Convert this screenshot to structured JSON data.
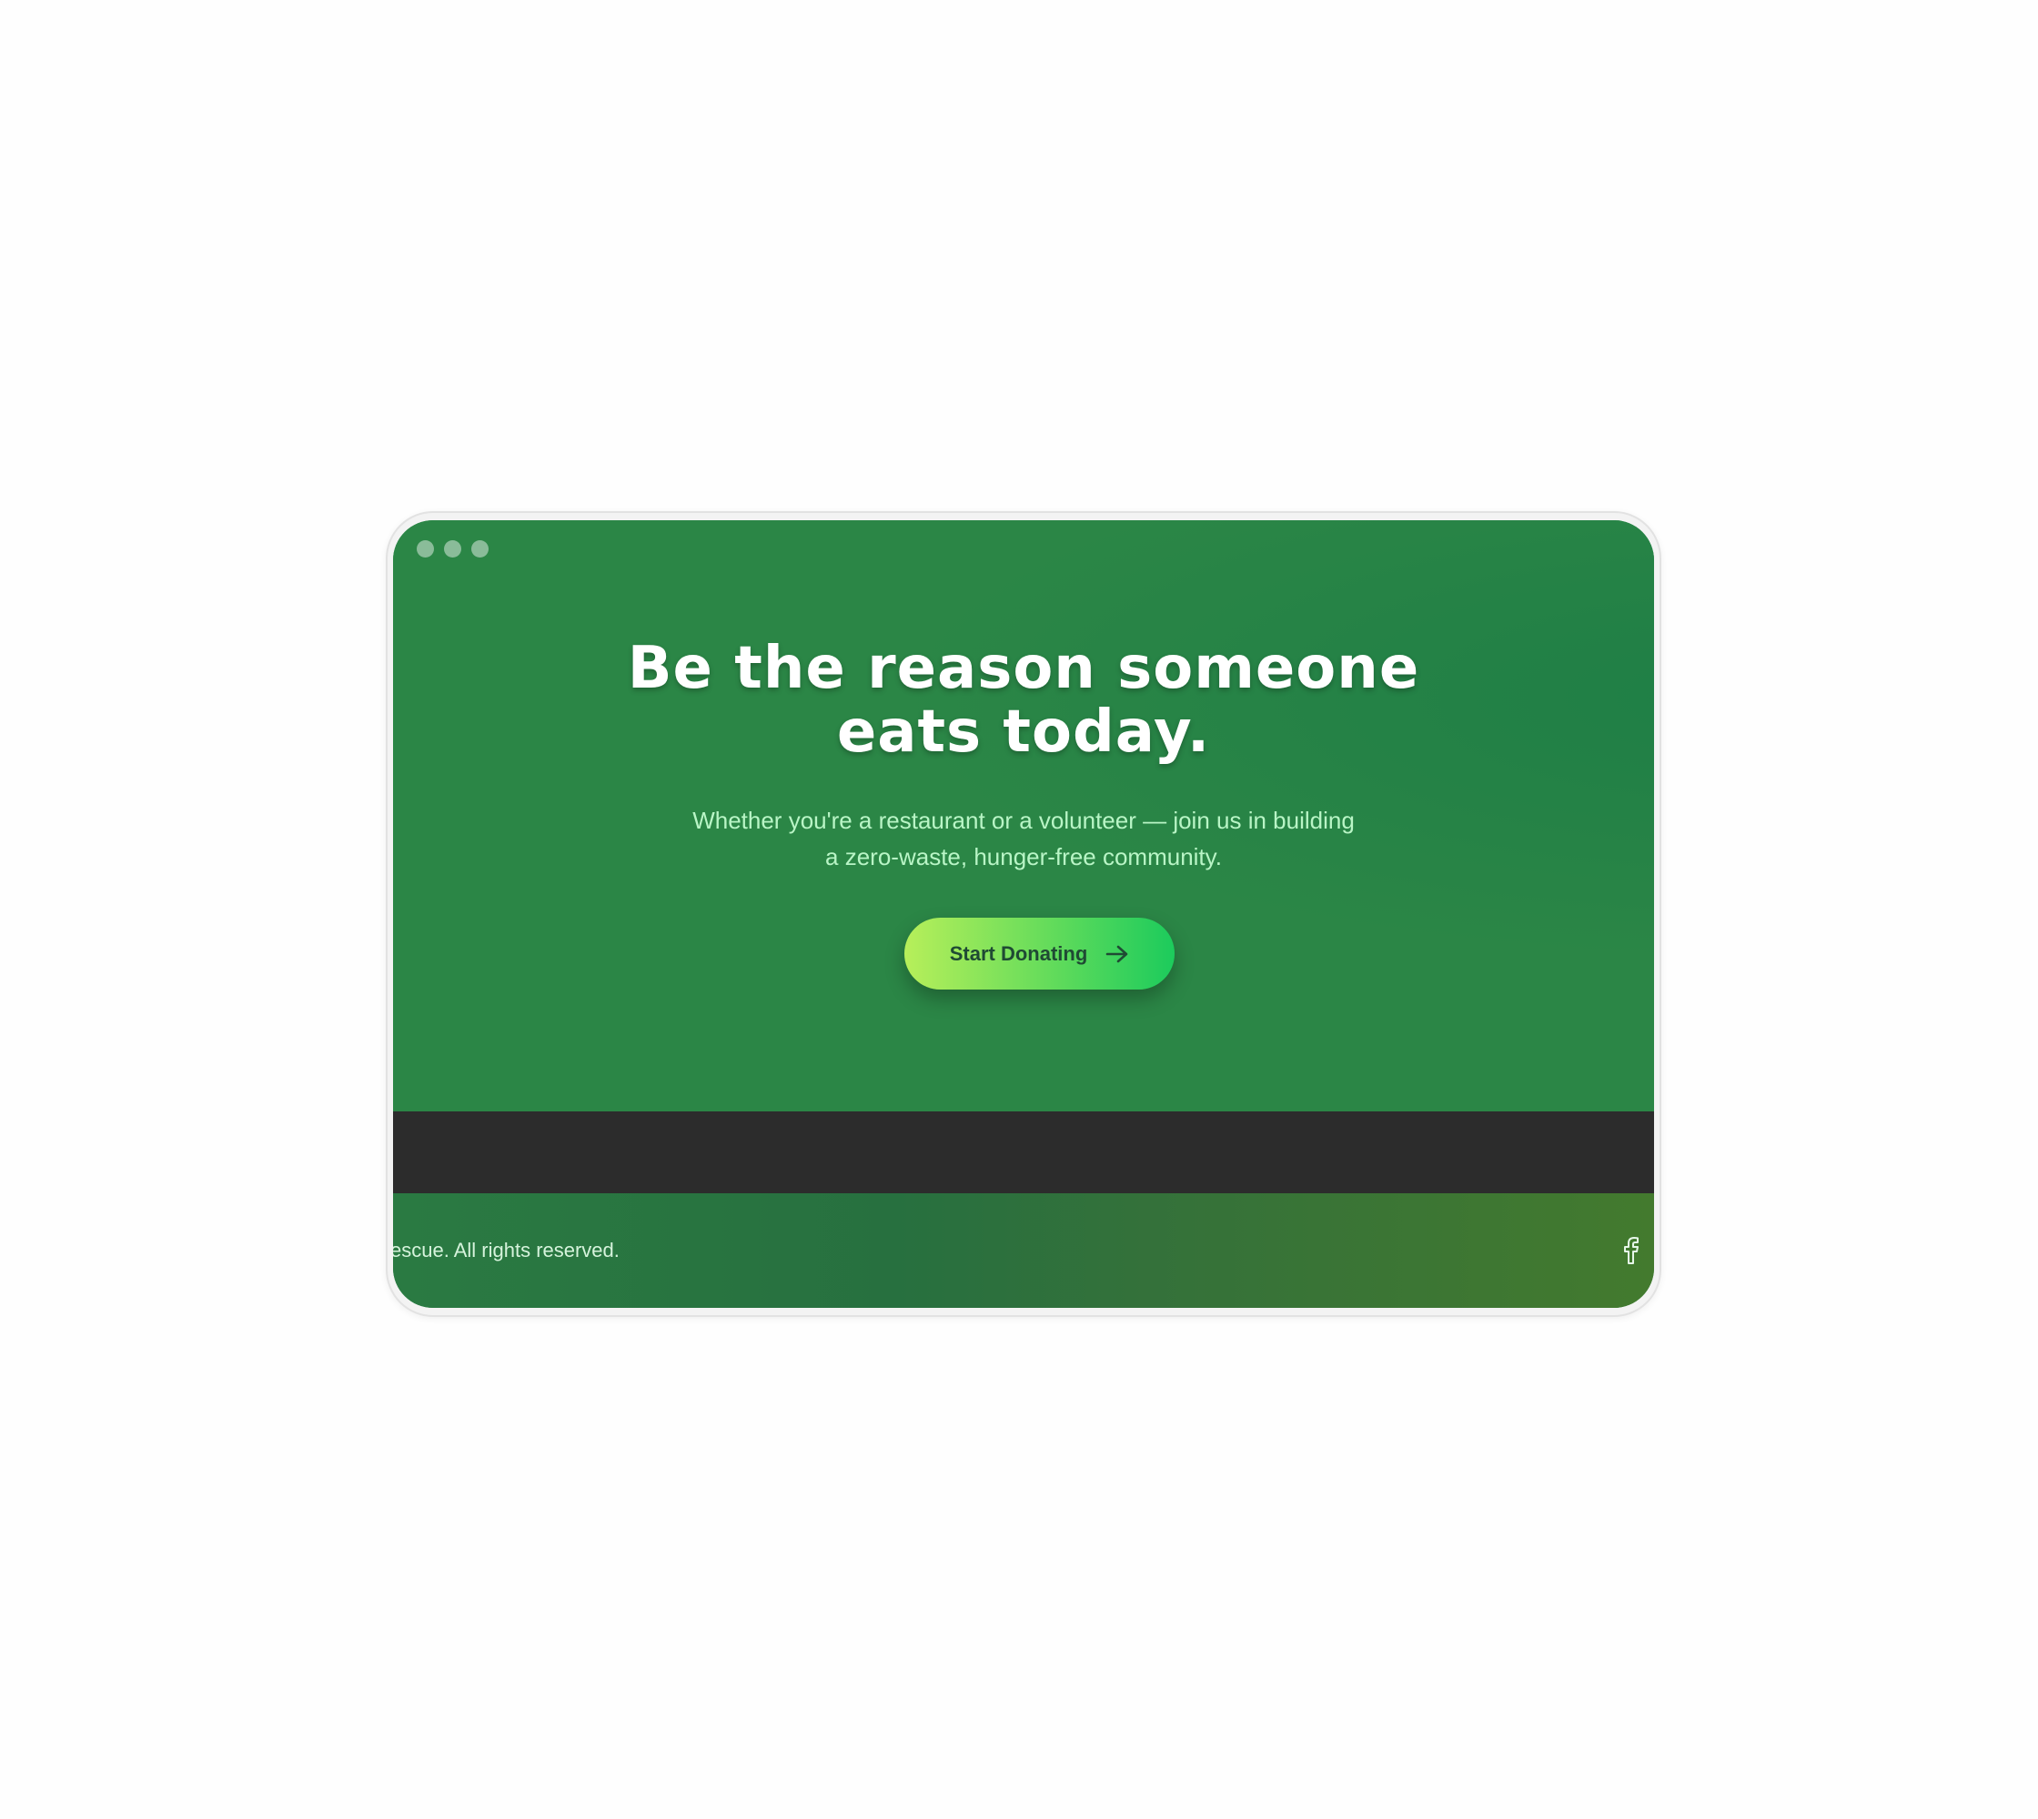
{
  "window": {
    "controls": [
      "dot",
      "dot",
      "dot"
    ]
  },
  "hero": {
    "headline_line1": "Be the reason someone",
    "headline_line2": "eats today.",
    "subtext_line1": "Whether you're a restaurant or a volunteer — join us in building",
    "subtext_line2": "a zero-waste, hunger-free community.",
    "cta_label": "Start Donating",
    "cta_icon": "arrow-right-icon"
  },
  "footer": {
    "copyright": "escue. All rights reserved.",
    "social_icon": "facebook-icon"
  },
  "colors": {
    "hero_bg": "#2b8646",
    "subtext": "#b9f5c6",
    "cta_gradient_start": "#b7ef5a",
    "cta_gradient_end": "#1ccb5c",
    "dark_band": "#2c2c2c",
    "footer_text": "#d6f3dc"
  }
}
